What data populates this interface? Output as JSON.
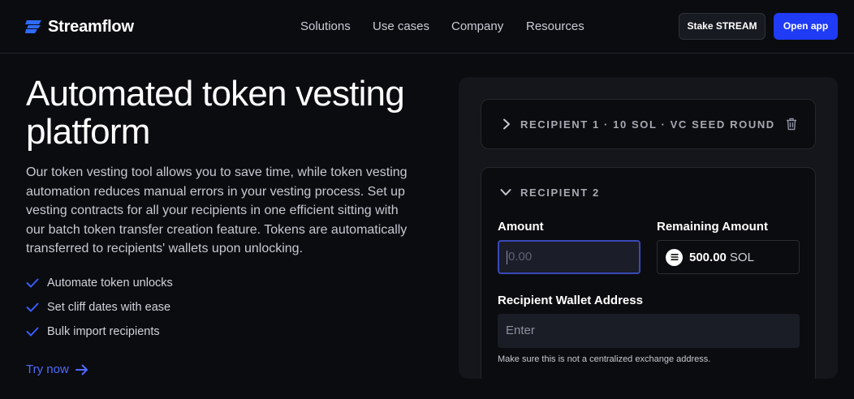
{
  "header": {
    "logo_text": "Streamflow",
    "nav": [
      "Solutions",
      "Use cases",
      "Company",
      "Resources"
    ],
    "stake_label": "Stake STREAM",
    "open_app_label": "Open app"
  },
  "hero": {
    "title_line1": "Automated token vesting",
    "title_line2": "platform",
    "description": "Our token vesting tool allows you to save time, while token vesting automation reduces manual errors in your vesting process. Set up vesting contracts for all your recipients in one efficient sitting with our batch token transfer creation feature. Tokens are automatically transferred to recipients' wallets upon unlocking.",
    "features": [
      "Automate token unlocks",
      "Set cliff dates with ease",
      "Bulk import recipients"
    ],
    "cta_label": "Try now"
  },
  "panel": {
    "recipient1_label": "RECIPIENT 1 · 10 SOL · VC SEED ROUND",
    "recipient2_label": "RECIPIENT 2",
    "amount_label": "Amount",
    "amount_placeholder": "0.00",
    "remaining_label": "Remaining Amount",
    "remaining_value": "500.00",
    "remaining_unit": "SOL",
    "wallet_label": "Recipient Wallet Address",
    "wallet_placeholder": "Enter",
    "wallet_hint": "Make sure this is not a centralized exchange address."
  },
  "colors": {
    "background": "#0b0c10",
    "accent": "#1f3bf5",
    "link": "#4f6bff",
    "check": "#3b5cff"
  }
}
